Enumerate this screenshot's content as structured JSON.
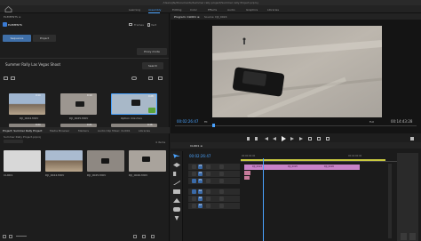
{
  "app": {
    "file_path": "/Users/jfe/Documents/Summer rally project/Summer rally Project.prproj",
    "workspaces": [
      "Learning",
      "Assembly",
      "Editing",
      "Color",
      "Effects",
      "Audio",
      "Graphics",
      "Libraries"
    ],
    "active_workspace": "Assembly"
  },
  "elements": {
    "brand": "ELEMENTS",
    "tab_title": "ELEMENTS ≡",
    "filter_frames": "Frames",
    "filter_vert": "Vert",
    "sequence_btn": "Sequence",
    "project_btn": "Project",
    "proxy_btn": "Proxy mode",
    "project_name": "Summer Rally Las Vegas Shoot",
    "search_btn": "Search",
    "thumbs": [
      {
        "label": "DJI_0024.MOV",
        "duration": "0:14"
      },
      {
        "label": "DJI_0025.MOV",
        "duration": "0:19"
      },
      {
        "label": "Option mix.mov",
        "duration": "0:28"
      }
    ],
    "row2_durations": [
      "0:24",
      "0:21",
      "0:16"
    ]
  },
  "project": {
    "tabs": [
      "Project: Summer Rally Project",
      "Media Browser",
      "Markers",
      "Audio Clip Mixer: CLI001",
      "Libraries"
    ],
    "file": "Summer Rally Project.prproj",
    "count": "4 items",
    "clips": [
      "CLI001",
      "DJI_0024.MOV",
      "DJI_0025.MOV",
      "DJI_0026.MOV"
    ]
  },
  "program": {
    "tabs": [
      "Program: CLI001 ≡",
      "Source: DJI_0024"
    ],
    "timecode": "00:02:26:47",
    "fit": "Fit",
    "quality": "Full",
    "duration": "00:14:43:28"
  },
  "timeline": {
    "sequence": "CLI001 ≡",
    "timecode": "00:02:26:47",
    "ruler_left": "00:00:00:00",
    "ruler_right": "00:02:00:00",
    "video_tracks": [
      "V3",
      "V2",
      "V1"
    ],
    "audio_tracks": [
      "A1",
      "A2",
      "A3"
    ],
    "clip_labels": [
      "DJI_0024",
      "DJI_0025",
      "DJI_0026"
    ]
  },
  "colors": {
    "accent": "#4aa3ff",
    "video_clip": "#c882c8",
    "audio_clip": "#7fb0b0",
    "button_blue": "#3f6fa8"
  }
}
